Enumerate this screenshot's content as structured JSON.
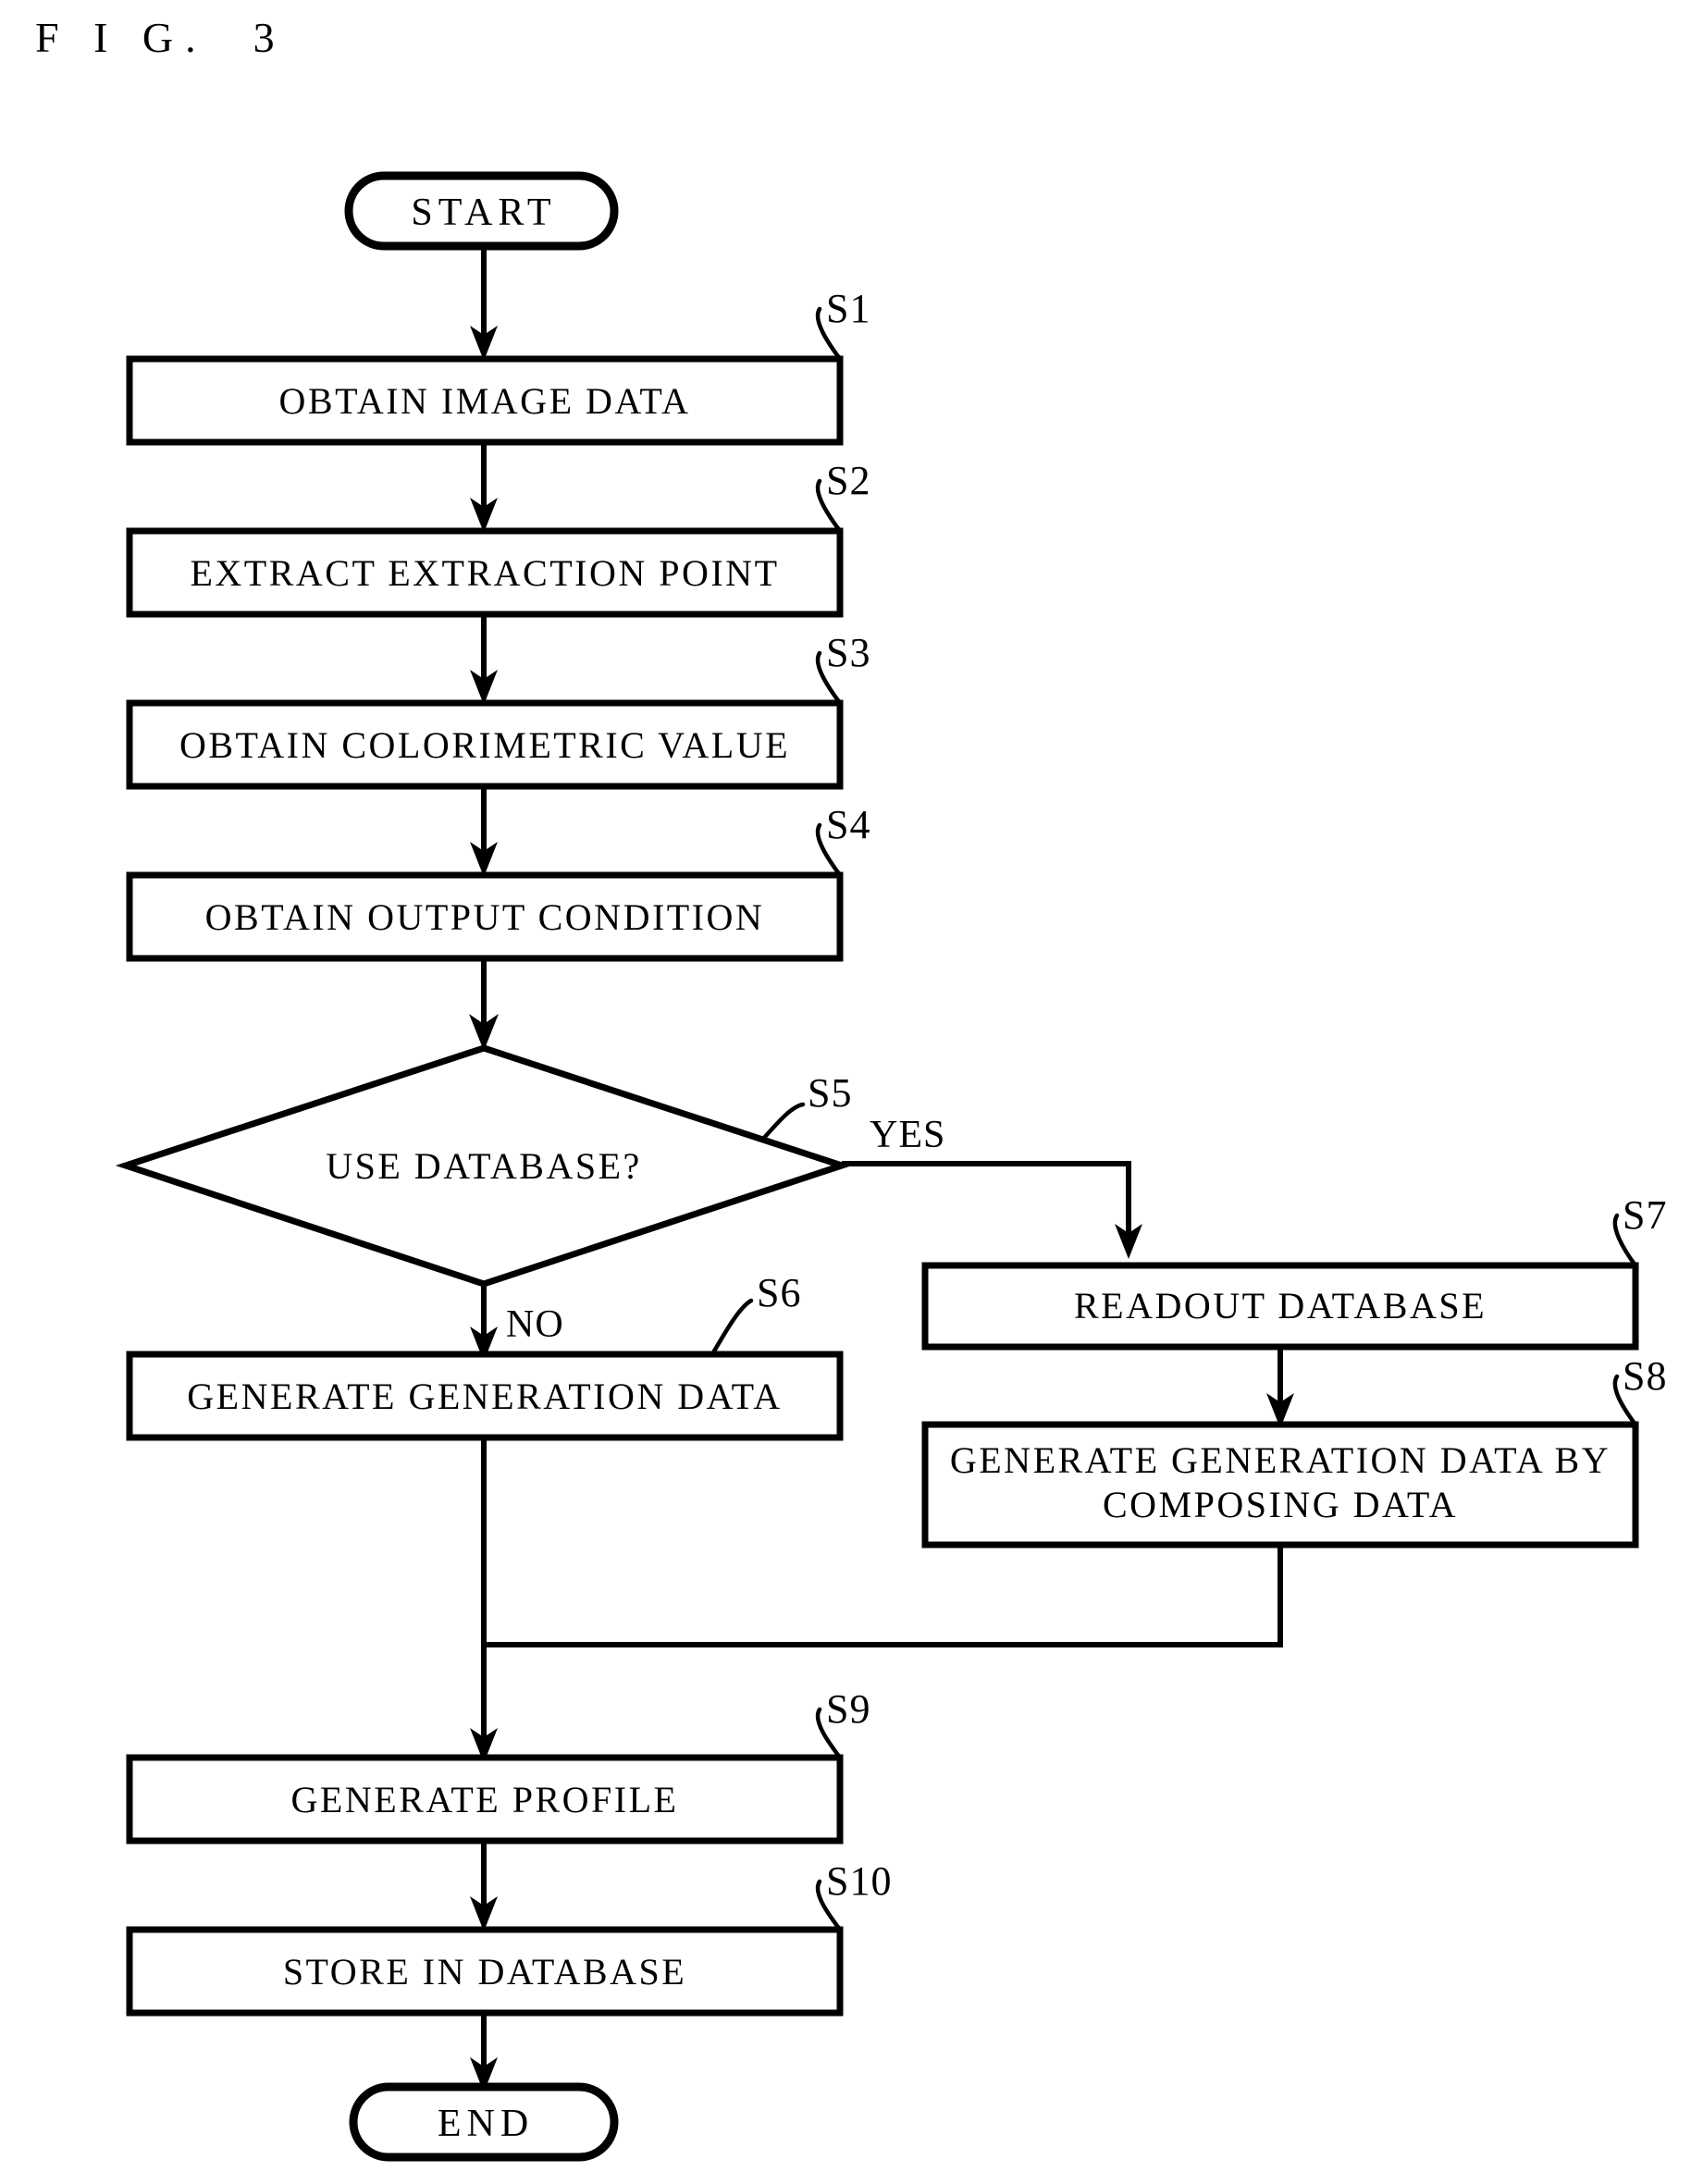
{
  "figure": {
    "title": "F I G.  3",
    "title_plain": "FIG. 3",
    "type": "flowchart"
  },
  "chart_data": {
    "type": "diagram",
    "title": "FIG. 3",
    "nodes": [
      {
        "id": "start",
        "shape": "terminator",
        "label": "START",
        "step": ""
      },
      {
        "id": "s1",
        "shape": "process",
        "label": "OBTAIN IMAGE DATA",
        "step": "S1"
      },
      {
        "id": "s2",
        "shape": "process",
        "label": "EXTRACT EXTRACTION POINT",
        "step": "S2"
      },
      {
        "id": "s3",
        "shape": "process",
        "label": "OBTAIN COLORIMETRIC VALUE",
        "step": "S3"
      },
      {
        "id": "s4",
        "shape": "process",
        "label": "OBTAIN OUTPUT CONDITION",
        "step": "S4"
      },
      {
        "id": "s5",
        "shape": "decision",
        "label": "USE DATABASE?",
        "step": "S5"
      },
      {
        "id": "s6",
        "shape": "process",
        "label": "GENERATE GENERATION DATA",
        "step": "S6"
      },
      {
        "id": "s7",
        "shape": "process",
        "label": "READOUT DATABASE",
        "step": "S7"
      },
      {
        "id": "s8",
        "shape": "process",
        "label_line1": "GENERATE GENERATION DATA BY",
        "label_line2": "COMPOSING DATA",
        "step": "S8"
      },
      {
        "id": "s9",
        "shape": "process",
        "label": "GENERATE PROFILE",
        "step": "S9"
      },
      {
        "id": "s10",
        "shape": "process",
        "label": "STORE IN DATABASE",
        "step": "S10"
      },
      {
        "id": "end",
        "shape": "terminator",
        "label": "END",
        "step": ""
      }
    ],
    "edges": [
      {
        "from": "start",
        "to": "s1",
        "label": ""
      },
      {
        "from": "s1",
        "to": "s2",
        "label": ""
      },
      {
        "from": "s2",
        "to": "s3",
        "label": ""
      },
      {
        "from": "s3",
        "to": "s4",
        "label": ""
      },
      {
        "from": "s4",
        "to": "s5",
        "label": ""
      },
      {
        "from": "s5",
        "to": "s6",
        "label": "NO"
      },
      {
        "from": "s5",
        "to": "s7",
        "label": "YES"
      },
      {
        "from": "s7",
        "to": "s8",
        "label": ""
      },
      {
        "from": "s6",
        "to": "s9",
        "label": ""
      },
      {
        "from": "s8",
        "to": "s9",
        "label": ""
      },
      {
        "from": "s9",
        "to": "s10",
        "label": ""
      },
      {
        "from": "s10",
        "to": "end",
        "label": ""
      }
    ],
    "branch_labels": {
      "yes": "YES",
      "no": "NO"
    },
    "colors": {
      "stroke": "#000000",
      "fill": "#ffffff",
      "text": "#000000"
    }
  },
  "nodes": {
    "start": {
      "label": "START"
    },
    "s1": {
      "label": "OBTAIN IMAGE DATA",
      "step": "S1"
    },
    "s2": {
      "label": "EXTRACT EXTRACTION POINT",
      "step": "S2"
    },
    "s3": {
      "label": "OBTAIN COLORIMETRIC VALUE",
      "step": "S3"
    },
    "s4": {
      "label": "OBTAIN OUTPUT CONDITION",
      "step": "S4"
    },
    "s5": {
      "label": "USE DATABASE?",
      "step": "S5"
    },
    "s6": {
      "label": "GENERATE GENERATION DATA",
      "step": "S6"
    },
    "s7": {
      "label": "READOUT DATABASE",
      "step": "S7"
    },
    "s8": {
      "label_line1": "GENERATE GENERATION DATA BY",
      "label_line2": "COMPOSING DATA",
      "step": "S8"
    },
    "s9": {
      "label": "GENERATE PROFILE",
      "step": "S9"
    },
    "s10": {
      "label": "STORE IN DATABASE",
      "step": "S10"
    },
    "end": {
      "label": "END"
    }
  },
  "branches": {
    "yes": "YES",
    "no": "NO"
  }
}
